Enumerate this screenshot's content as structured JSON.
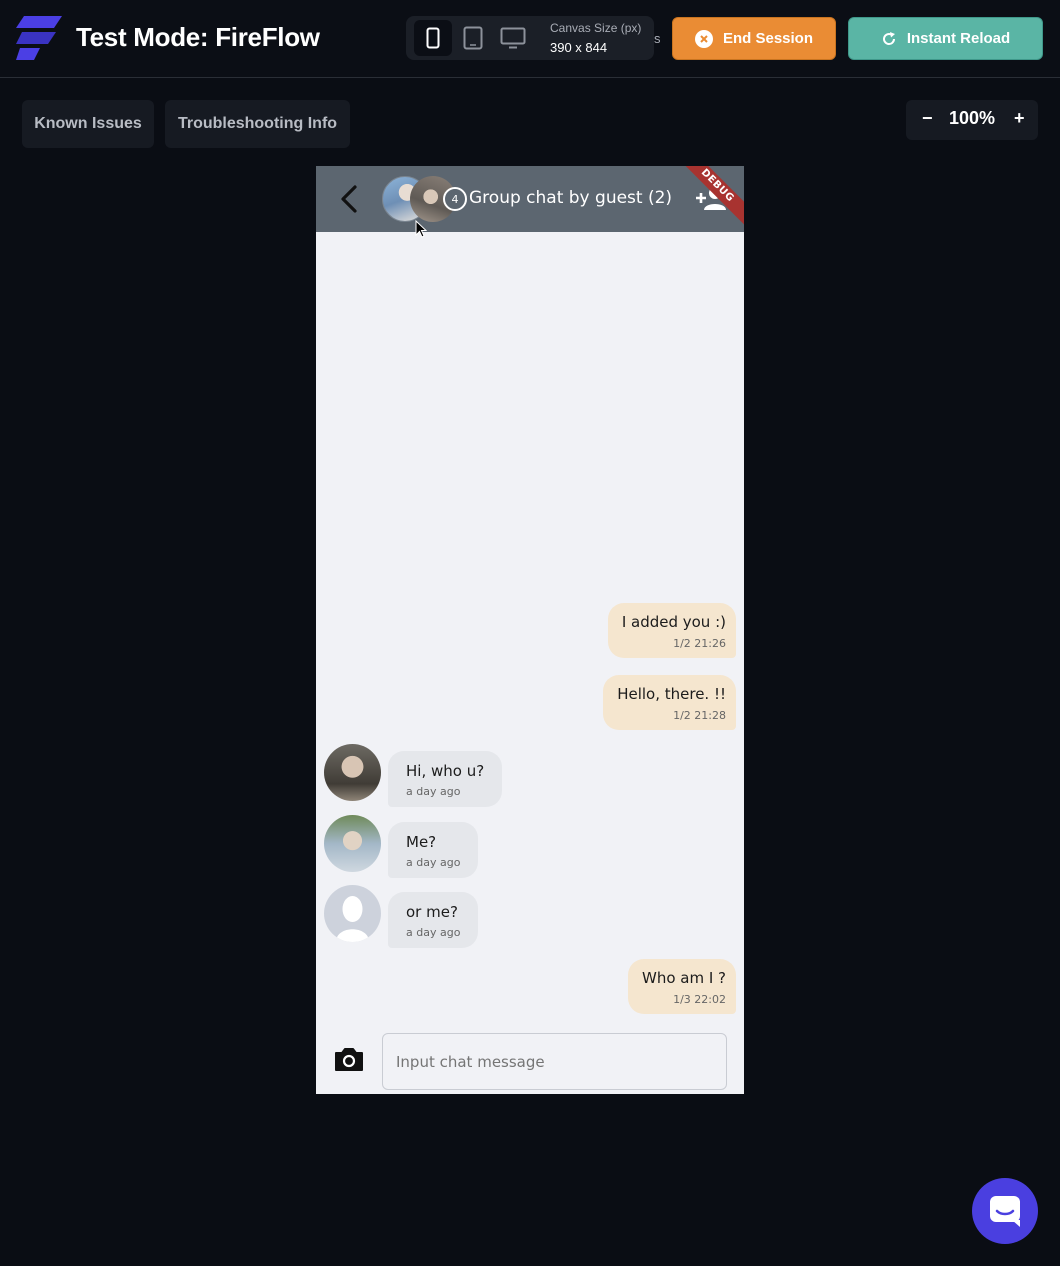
{
  "header": {
    "title": "Test Mode: FireFlow",
    "canvas_label": "Canvas Size (px)",
    "canvas_value": "390 x 844",
    "truncated_char": "s",
    "end_session_label": "End Session",
    "instant_reload_label": "Instant Reload",
    "accent_orange": "#ea8c34",
    "accent_teal": "#5ab5a5"
  },
  "toolbar": {
    "known_issues_label": "Known Issues",
    "troubleshooting_label": "Troubleshooting Info",
    "zoom_minus": "−",
    "zoom_value": "100%",
    "zoom_plus": "+"
  },
  "phone": {
    "member_count": "4",
    "chat_title": "Group chat by guest (2)",
    "debug_banner": "DEBUG",
    "messages": [
      {
        "side": "out",
        "text": "I added you :)",
        "time": "1/2 21:26"
      },
      {
        "side": "out",
        "text": "Hello, there. !!",
        "time": "1/2 21:28"
      },
      {
        "side": "in",
        "text": "Hi, who u?",
        "time": "a day ago"
      },
      {
        "side": "in",
        "text": "Me?",
        "time": "a day ago"
      },
      {
        "side": "in",
        "text": "or me?",
        "time": "a day ago"
      },
      {
        "side": "out",
        "text": "Who am I ?",
        "time": "1/3 22:02"
      }
    ],
    "input_placeholder": "Input chat message"
  }
}
